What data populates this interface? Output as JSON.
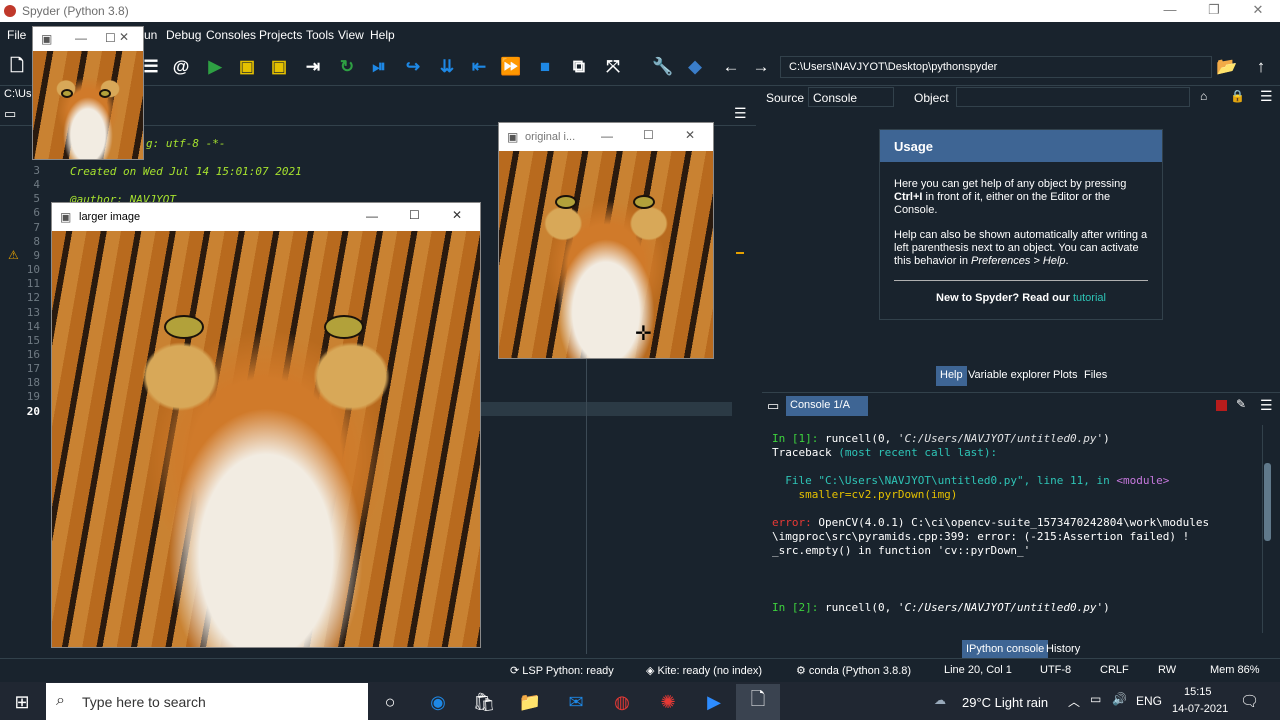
{
  "app": {
    "title": "Spyder (Python 3.8)"
  },
  "menu": [
    "File",
    "un",
    "Debug",
    "Consoles",
    "Projects",
    "Tools",
    "View",
    "Help"
  ],
  "path": "C:\\Users\\NAVJYOT\\Desktop\\pythonspyder",
  "left_path_fragment": "C:\\Us",
  "editor": {
    "line_numbers": [
      "3",
      "4",
      "5",
      "6",
      "7",
      "8",
      "9",
      "10",
      "11",
      "12",
      "13",
      "14",
      "15",
      "16",
      "17",
      "18",
      "19",
      "20"
    ],
    "code": [
      "g: utf-8 -*-",
      "Created on Wed Jul 14 15:01:07 2021",
      "@author: NAVJYOT"
    ]
  },
  "help_pane": {
    "source_label": "Source",
    "source_value": "Console",
    "object_label": "Object",
    "usage_title": "Usage",
    "p1a": "Here you can get help of any object by pressing",
    "p1b": "Ctrl+I",
    "p1c": " in front of it, either on the Editor or the Console.",
    "p2a": "Help can also be shown automatically after writing a left parenthesis next to an object. You can activate this behavior in ",
    "p2b": "Preferences > Help",
    "p2c": ".",
    "new_to": "New to Spyder? Read our ",
    "tutorial": "tutorial",
    "tabs": [
      "Help",
      "Variable explorer",
      "Plots",
      "Files"
    ]
  },
  "console": {
    "tab": "Console 1/A",
    "in1_prompt": "In [1]:",
    "in1_code": " runcell(0, ",
    "in1_str": "'C:/Users/NAVJYOT/untitled0.py'",
    "in1_end": ")",
    "traceback": "Traceback ",
    "traceback_rest": "(most recent call last):",
    "file_line_a": "  File ",
    "file_line_b": "\"C:\\Users\\NAVJYOT\\untitled0.py\"",
    "file_line_c": ", line ",
    "file_line_d": "11",
    "file_line_e": ", in ",
    "file_line_f": "<module>",
    "code_line": "    smaller=cv2.pyrDown(img)",
    "error_label": "error:",
    "error_1": " OpenCV(4.0.1) C:\\ci\\opencv-suite_1573470242804\\work\\modules",
    "error_2": "\\imgproc\\src\\pyramids.cpp:399: error: (-215:Assertion failed) !",
    "error_3": "_src.empty() in function 'cv::pyrDown_'",
    "in2_prompt": "In [2]:",
    "in2_code": " runcell(0, ",
    "in2_str": "'C:/Users/NAVJYOT/untitled0.py'",
    "in2_end": ")",
    "bottom_tabs": [
      "IPython console",
      "History"
    ]
  },
  "windows": {
    "larger": "larger image",
    "original": "original i..."
  },
  "statusbar": {
    "lsp": "LSP Python: ready",
    "kite": "Kite: ready (no index)",
    "conda": "conda (Python 3.8.8)",
    "pos": "Line 20, Col 1",
    "enc": "UTF-8",
    "eol": "CRLF",
    "rw": "RW",
    "mem": "Mem 86%"
  },
  "taskbar": {
    "search_placeholder": "Type here to search",
    "weather": "29°C  Light rain",
    "lang": "ENG",
    "time": "15:15",
    "date": "14-07-2021"
  },
  "colors": {
    "accent": "#3e6594",
    "bg": "#19232d",
    "taskbar": "#202732"
  }
}
